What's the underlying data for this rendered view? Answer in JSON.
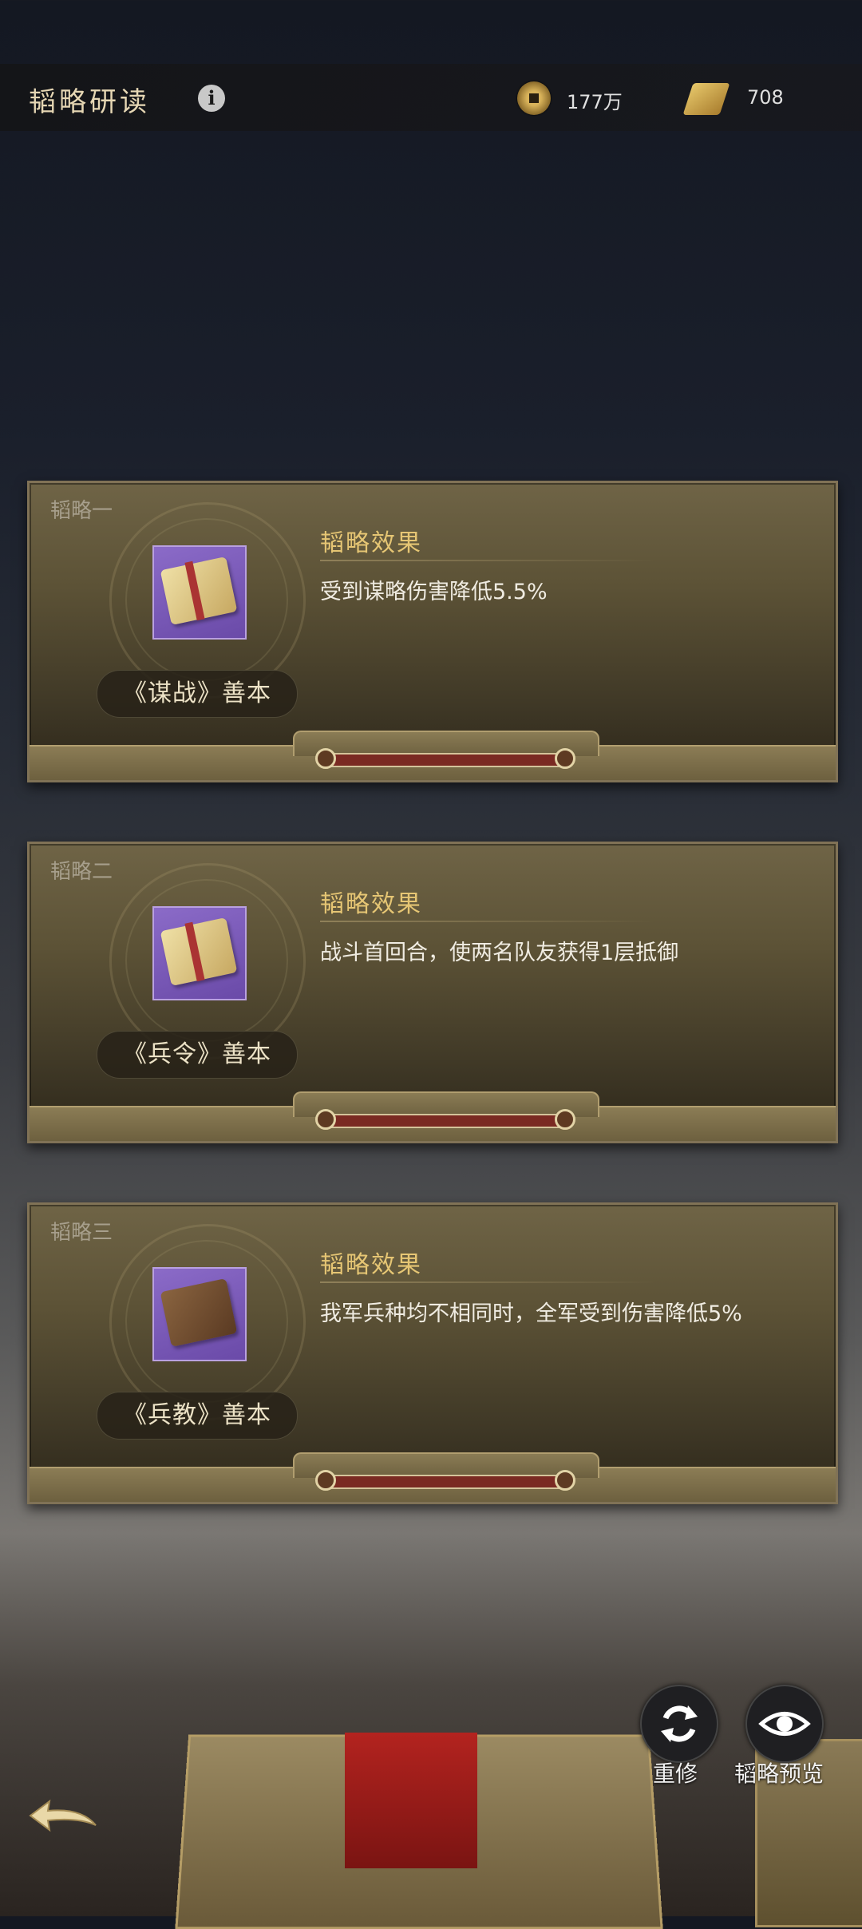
{
  "header": {
    "title": "韬略研读",
    "info_icon": "info-icon",
    "currency": [
      {
        "icon": "coin-icon",
        "value": "177万"
      },
      {
        "icon": "scroll-icon",
        "value": "708"
      }
    ]
  },
  "cards": [
    {
      "label": "韬略一",
      "item_name": "《谋战》善本",
      "effect_title": "韬略效果",
      "effect_text": "受到谋略伤害降低5.5%"
    },
    {
      "label": "韬略二",
      "item_name": "《兵令》善本",
      "effect_title": "韬略效果",
      "effect_text": "战斗首回合，使两名队友获得1层抵御"
    },
    {
      "label": "韬略三",
      "item_name": "《兵教》善本",
      "effect_title": "韬略效果",
      "effect_text": "我军兵种均不相同时，全军受到伤害降低5%"
    }
  ],
  "actions": {
    "reroll_label": "重修",
    "preview_label": "韬略预览"
  },
  "colors": {
    "accent_gold": "#e6c674",
    "card_bg": "#5c5236"
  }
}
